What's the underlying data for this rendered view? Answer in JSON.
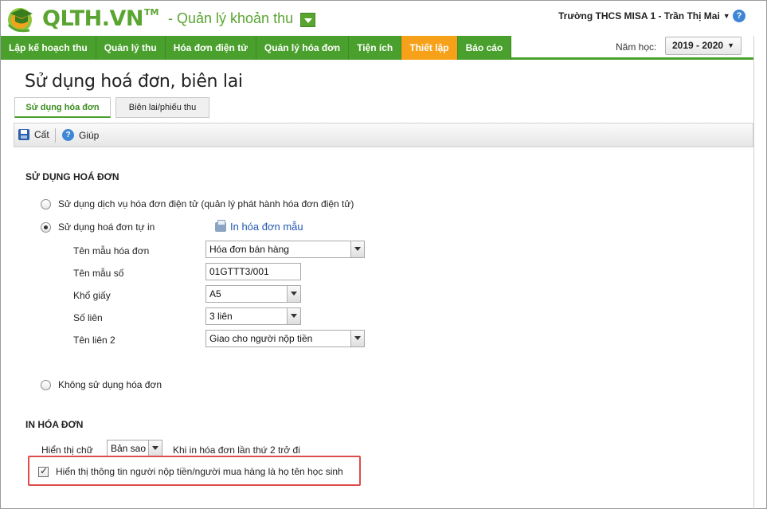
{
  "header": {
    "logo_text": "QLTH.VN",
    "logo_tm": "TM",
    "module_name": "- Quản lý khoản thu",
    "user_info": "Trường THCS MISA 1 - Trần Thị Mai",
    "help": "?"
  },
  "nav": {
    "items": [
      {
        "label": "Lập kế hoạch thu"
      },
      {
        "label": "Quản lý thu"
      },
      {
        "label": "Hóa đơn điện tử"
      },
      {
        "label": "Quản lý hóa đơn"
      },
      {
        "label": "Tiện ích"
      },
      {
        "label": "Thiết lập",
        "active": true
      },
      {
        "label": "Báo cáo"
      }
    ],
    "active_color": "#f7a11a",
    "brand_color": "#4aa02c",
    "year_label": "Năm học:",
    "year_value": "2019 - 2020"
  },
  "page": {
    "title": "Sử dụng hoá đơn, biên lai",
    "tabs": [
      {
        "label": "Sử dụng hóa đơn",
        "active": true
      },
      {
        "label": "Biên lai/phiếu thu"
      }
    ]
  },
  "toolbar": {
    "save_label": "Cất",
    "help_label": "Giúp"
  },
  "invoice_usage": {
    "section_title": "SỬ DỤNG HOÁ ĐƠN",
    "option_einvoice": "Sử dụng dịch vụ hóa đơn điện tử (quản lý phát hành hóa đơn điện tử)",
    "option_selfprint": "Sử dụng hoá đơn tự in",
    "option_none": "Không sử dụng hóa đơn",
    "selected": "selfprint",
    "print_sample_link": "In hóa đơn mẫu",
    "template_label": "Tên mẫu hóa đơn",
    "template_value": "Hóa đơn bán hàng",
    "template_no_label": "Tên mẫu số",
    "template_no_value": "01GTTT3/001",
    "paper_size_label": "Khổ giấy",
    "paper_size_value": "A5",
    "copies_label": "Số liên",
    "copies_value": "3 liên",
    "copy2_label": "Tên liên 2",
    "copy2_value": "Giao cho người nộp tiền"
  },
  "print_invoice": {
    "section_title": "IN HÓA ĐƠN",
    "show_text_label": "Hiển thị chữ",
    "show_text_value": "Bản sao",
    "show_text_note": "Khi in hóa đơn lần thứ 2 trở đi",
    "checkbox_label": "Hiển thị thông tin người nộp tiền/người mua hàng là họ tên học sinh",
    "checkbox_checked": true,
    "highlight_color": "#e04b4b"
  }
}
